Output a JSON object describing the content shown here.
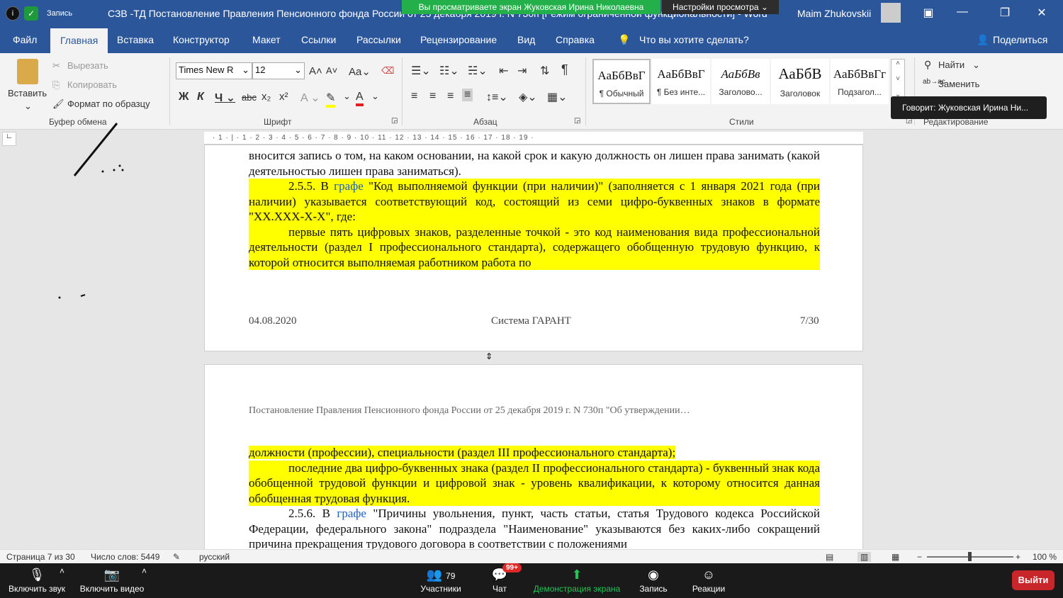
{
  "titlebar": {
    "record": "Запись",
    "doc_title": "СЗВ -ТД Постановление Правления Пенсионного фонда России от 25 декабря 2019 г. N 730п [Режим ограниченной функциональности] - Word",
    "user": "Maim Zhukovskii"
  },
  "zoom_banner": {
    "viewing": "Вы просматриваете экран Жуковская Ирина Николаевна",
    "settings": "Настройки просмотра"
  },
  "menu": {
    "file": "Файл",
    "home": "Главная",
    "insert": "Вставка",
    "design": "Конструктор",
    "layout": "Макет",
    "references": "Ссылки",
    "mailings": "Рассылки",
    "review": "Рецензирование",
    "view": "Вид",
    "help": "Справка",
    "tell_me": "Что вы хотите сделать?",
    "share": "Поделиться"
  },
  "ribbon": {
    "paste": "Вставить",
    "cut": "Вырезать",
    "copy": "Копировать",
    "format_painter": "Формат по образцу",
    "clipboard": "Буфер обмена",
    "font_name": "Times New R",
    "font_size": "12",
    "font": "Шрифт",
    "paragraph": "Абзац",
    "styles": "Стили",
    "find": "Найти",
    "replace": "Заменить",
    "editing": "Редактирование",
    "style_tiles": [
      {
        "sample": "АаБбВвГ",
        "name": "¶ Обычный"
      },
      {
        "sample": "АаБбВвГ",
        "name": "¶ Без инте..."
      },
      {
        "sample": "АаБбВв",
        "name": "Заголово..."
      },
      {
        "sample": "АаБбВ",
        "name": "Заголовок"
      },
      {
        "sample": "АаБбВвГг",
        "name": "Подзагол..."
      }
    ]
  },
  "tooltip": "Говорит: Жуковская Ирина Ни...",
  "ruler": "· 1 · | · 1 · 2 · 3 · 4 · 5 · 6 · 7 · 8 · 9 · 10 · 11 · 12 · 13 · 14 · 15 · 16 · 17 · 18 · 19 ·",
  "page1": {
    "p1": "вносится запись о том, на каком основании, на какой срок и какую должность он лишен права занимать (какой деятельностью лишен права заниматься).",
    "p2_a": "2.5.5. В ",
    "p2_link": "графе",
    "p2_b": " \"Код выполняемой функции (при наличии)\" (заполняется с 1 января 2021 года (при наличии) указывается соответствующий код, состоящий из семи цифро-буквенных знаков в формате \"XX.XXX-X-X\", где:",
    "p3": "первые пять цифровых знаков, разделенные точкой - это код наименования вида профессиональной деятельности (раздел I профессионального стандарта), содержащего обобщенную трудовую функцию, к которой относится выполняемая работником работа по",
    "footer_date": "04.08.2020",
    "footer_system": "Система ГАРАНТ",
    "footer_page": "7/30"
  },
  "page2": {
    "header": "Постановление Правления Пенсионного фонда России от 25 декабря 2019 г. N 730п \"Об утверждении…",
    "p1": "должности (профессии), специальности (раздел III профессионального стандарта);",
    "p2": "последние два цифро-буквенных знака (раздел II профессионального стандарта) - буквенный знак кода обобщенной трудовой функции и цифровой знак - уровень квалификации, к которому относится данная обобщенная трудовая функция.",
    "p3_a": "2.5.6. В ",
    "p3_link": "графе",
    "p3_b": " \"Причины увольнения, пункт, часть статьи, статья Трудового кодекса Российской Федерации, федерального закона\" подраздела \"Наименование\" указываются без каких-либо сокращений причина прекращения трудового договора в соответствии с положениями"
  },
  "status": {
    "page": "Страница 7 из 30",
    "words": "Число слов: 5449",
    "lang": "русский",
    "zoom": "100 %"
  },
  "zoom_controls": {
    "mute": "Включить звук",
    "video": "Включить видео",
    "participants": "Участники",
    "participants_count": "79",
    "chat": "Чат",
    "chat_badge": "99+",
    "share": "Демонстрация экрана",
    "record": "Запись",
    "reactions": "Реакции",
    "leave": "Выйти"
  }
}
